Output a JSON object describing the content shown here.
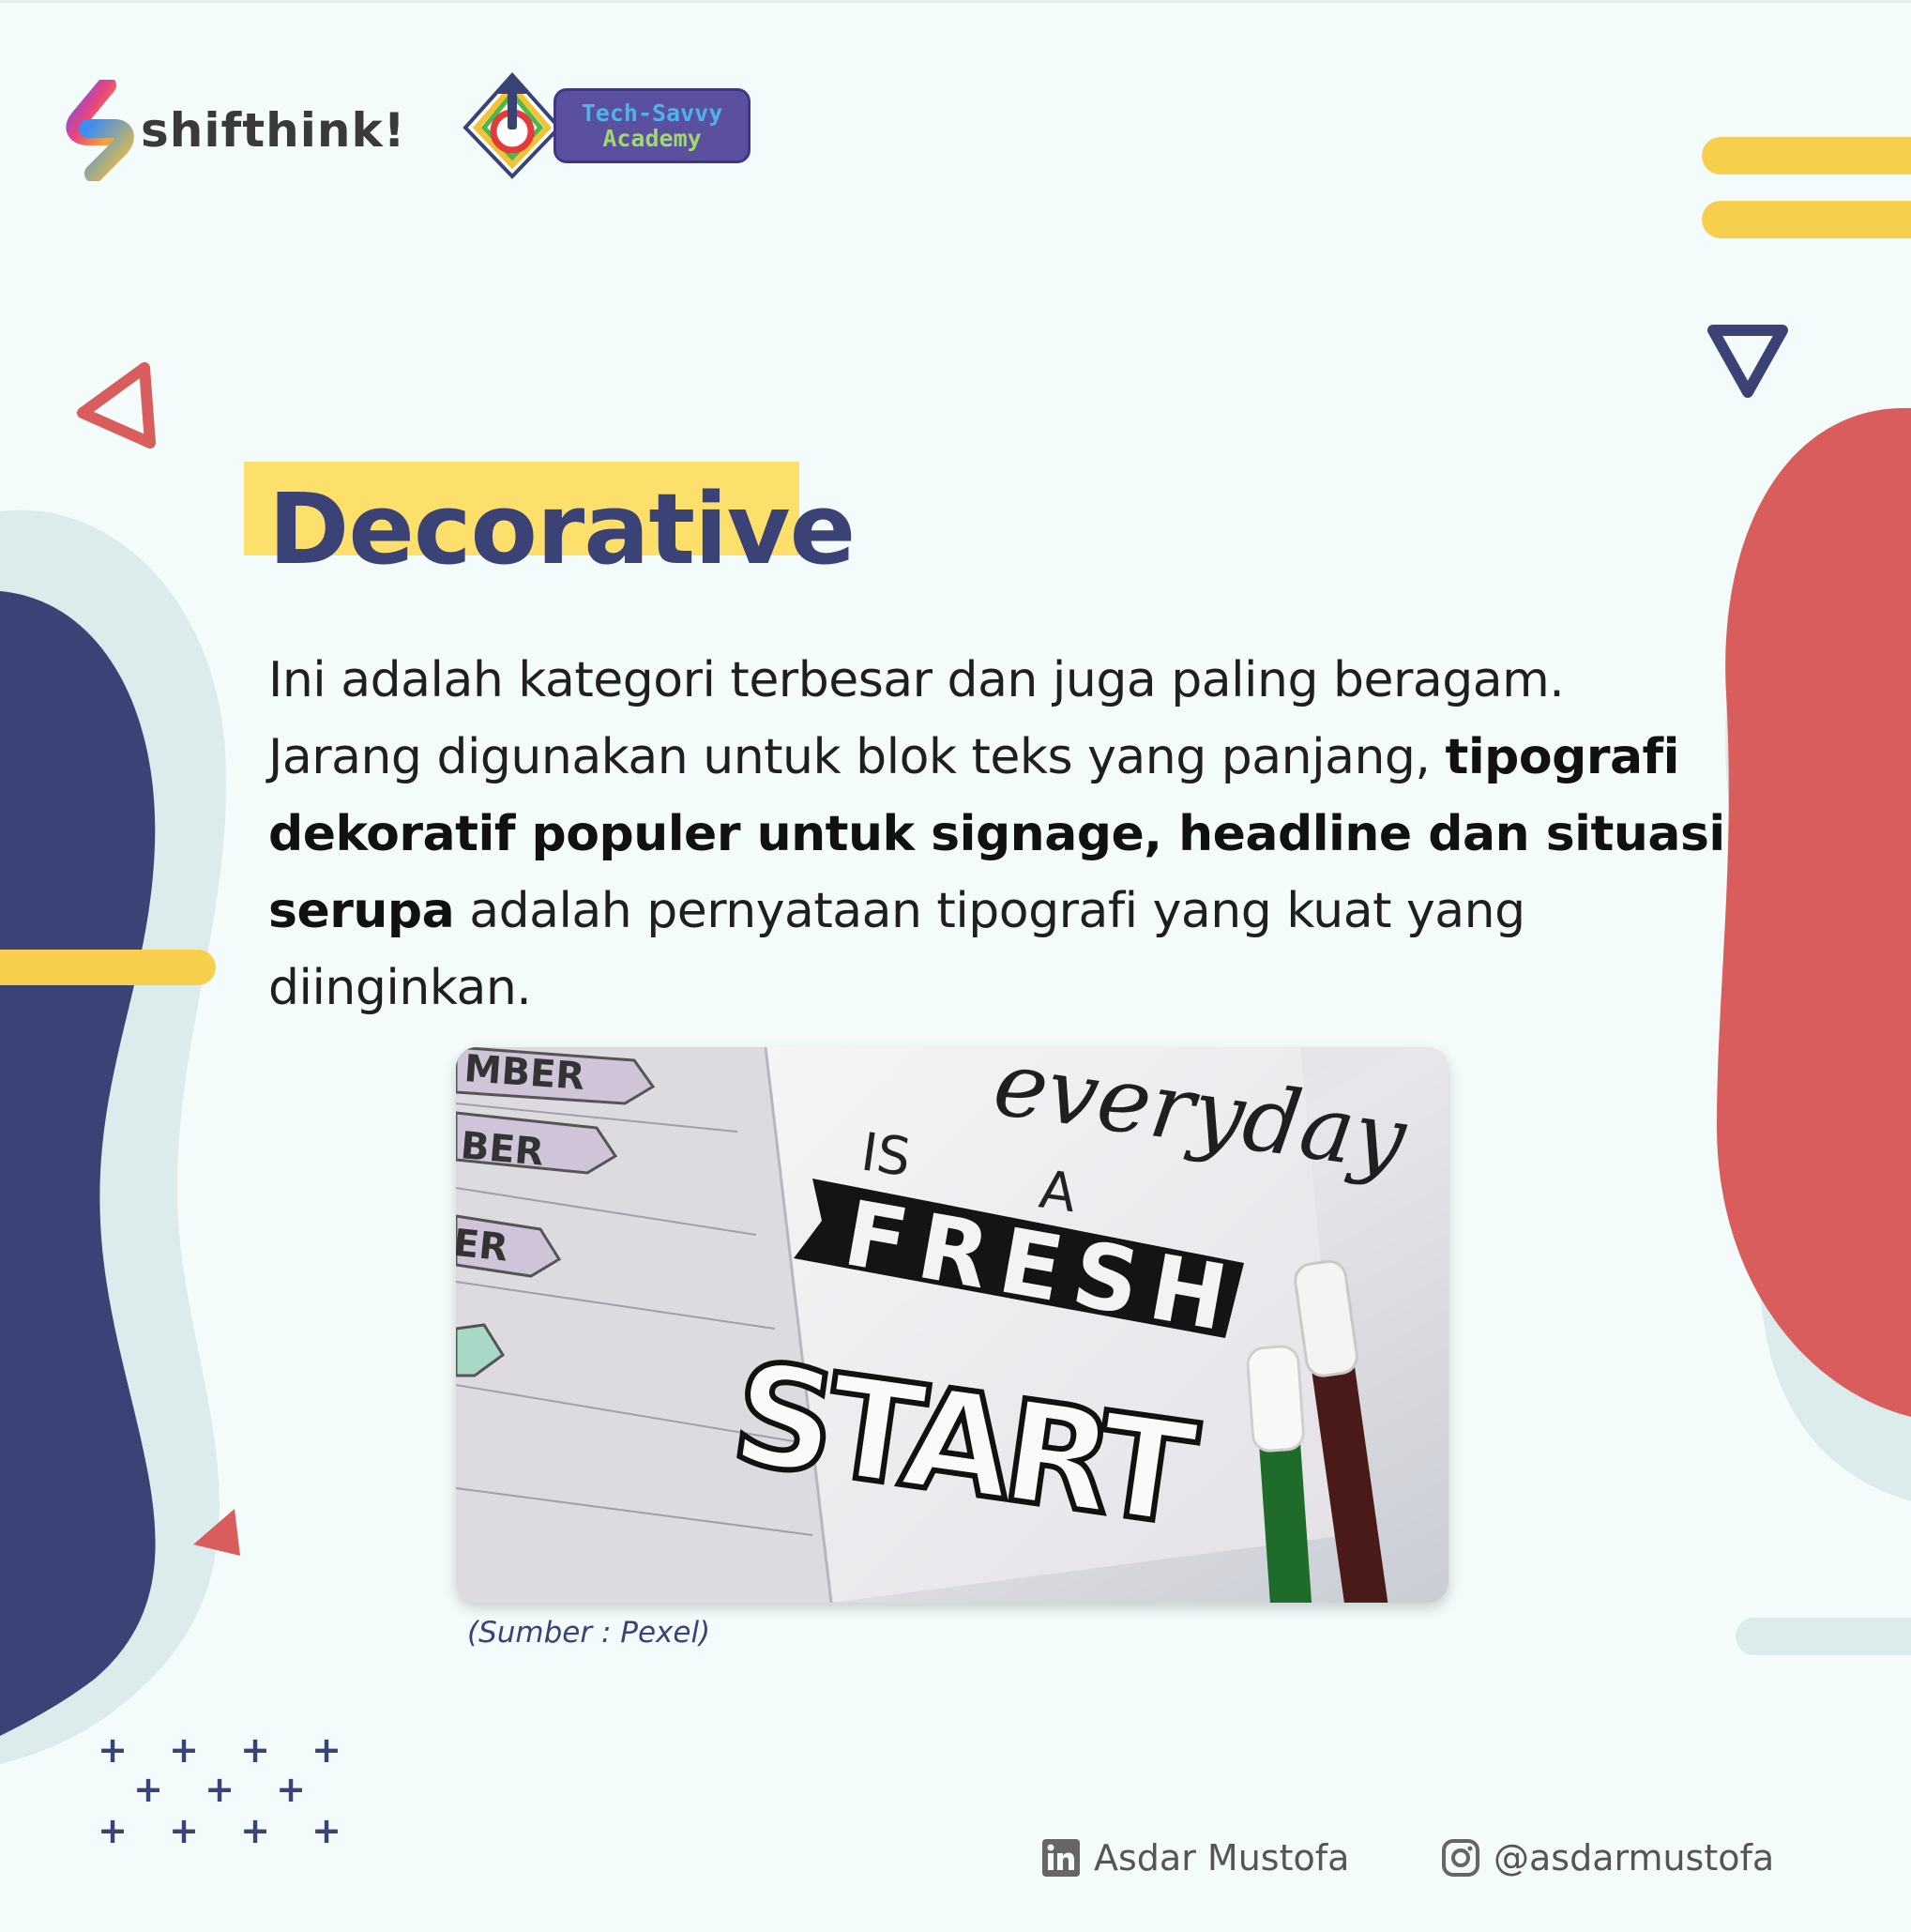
{
  "brand": {
    "name": "shifthink!"
  },
  "academy": {
    "line1": "Tech-Savvy",
    "line2": "Academy"
  },
  "title": "Decorative",
  "body": {
    "part1": "Ini adalah kategori terbesar dan juga paling beragam. Jarang digunakan untuk blok teks yang panjang, ",
    "bold": "tipografi dekoratif populer untuk signage, headline dan situasi serupa",
    "part2": " adalah pernyataan tipografi yang kuat yang diinginkan."
  },
  "image": {
    "caption": "(Sumber : Pexel)",
    "lettering": [
      "everyday",
      "IS",
      "A",
      "FRESH",
      "START"
    ],
    "margin_words": [
      "MBER",
      "BER",
      "ER"
    ]
  },
  "footer": {
    "linkedin": "Asdar Mustofa",
    "instagram": "@asdarmustofa",
    "icons": [
      "linkedin-icon",
      "instagram-icon"
    ]
  },
  "colors": {
    "background": "#f4fbfb",
    "navy": "#3b4276",
    "red": "#d95d5d",
    "yellow": "#f6d04d",
    "highlight": "#fddf6c",
    "light_teal": "#dcebec"
  }
}
